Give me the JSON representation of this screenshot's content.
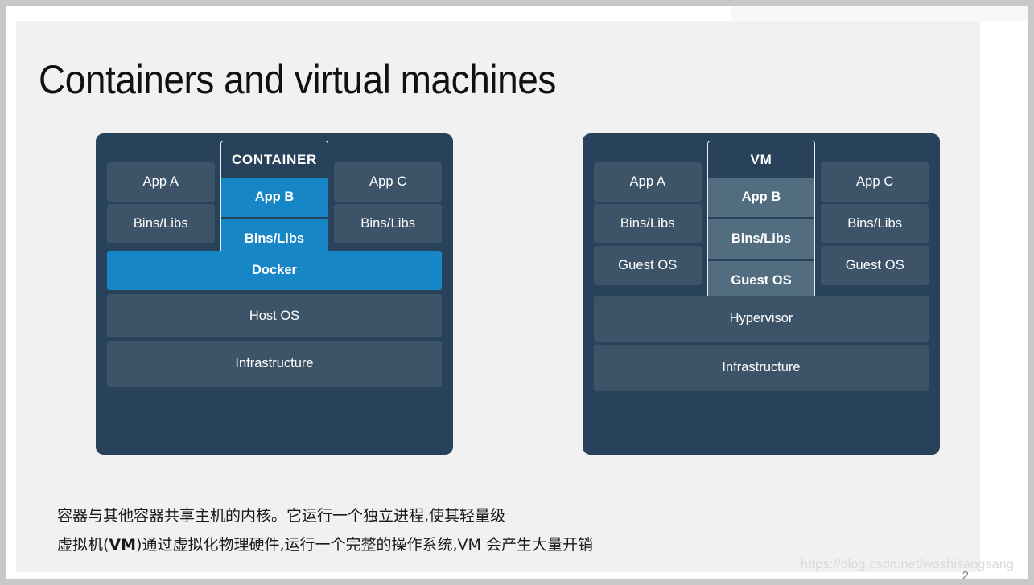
{
  "slide": {
    "title": "Containers and virtual machines",
    "page_number": "2",
    "watermark": "https://blog.csdn.net/woshisangsang",
    "background_color": "#f1f1f1"
  },
  "colors": {
    "panel": "#27425a",
    "cell": "#3d5468",
    "accent_blue": "#1786c6",
    "accent_slate": "#536d80",
    "text": "#ffffff"
  },
  "diagrams": [
    {
      "id": "container-diagram",
      "highlight_label": "CONTAINER",
      "highlight_style": "blue",
      "columns": [
        {
          "app": "App A",
          "libs": "Bins/Libs"
        },
        {
          "app": "App B",
          "libs": "Bins/Libs"
        },
        {
          "app": "App C",
          "libs": "Bins/Libs"
        }
      ],
      "bars": [
        {
          "label": "Docker",
          "style": "blue"
        },
        {
          "label": "Host OS",
          "style": "plain"
        },
        {
          "label": "Infrastructure",
          "style": "plain"
        }
      ]
    },
    {
      "id": "vm-diagram",
      "highlight_label": "VM",
      "highlight_style": "slate",
      "columns": [
        {
          "app": "App A",
          "libs": "Bins/Libs",
          "guest": "Guest OS"
        },
        {
          "app": "App B",
          "libs": "Bins/Libs",
          "guest": "Guest OS"
        },
        {
          "app": "App C",
          "libs": "Bins/Libs",
          "guest": "Guest OS"
        }
      ],
      "bars": [
        {
          "label": "Hypervisor",
          "style": "plain"
        },
        {
          "label": "Infrastructure",
          "style": "plain"
        }
      ]
    }
  ],
  "caption": {
    "line1": "容器与其他容器共享主机的内核。它运行一个独立进程,使其轻量级",
    "line2_prefix": "虚拟机(",
    "line2_bold": "VM",
    "line2_suffix": ")通过虚拟化物理硬件,运行一个完整的操作系统,VM 会产生大量开销"
  }
}
